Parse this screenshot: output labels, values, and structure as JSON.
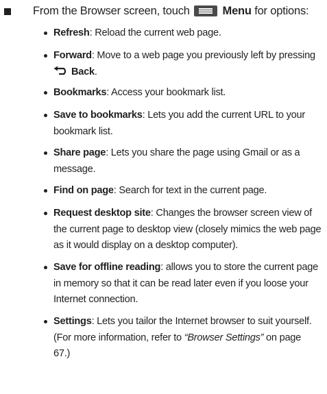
{
  "intro": {
    "before": "From the Browser screen, touch ",
    "menu_label": "Menu",
    "after": " for options:"
  },
  "items": [
    {
      "term": "Refresh",
      "line1": ": Reload the current web page."
    },
    {
      "term": "Forward",
      "line1": ": Move to a web page you previously left by pressing",
      "back_label": "Back",
      "back_after": "."
    },
    {
      "term": "Bookmarks",
      "line1": ": Access your bookmark list."
    },
    {
      "term": "Save to bookmarks",
      "line1": ": Lets you add the current URL to your",
      "line2": "bookmark list."
    },
    {
      "term": "Share page",
      "line1": ": Lets you share the page using Gmail or as a",
      "line2": "message."
    },
    {
      "term": "Find on page",
      "line1": ": Search for text in the current page."
    },
    {
      "term": "Request desktop site",
      "line1": ": Changes the browser screen view of",
      "line2": "the current page to desktop view (closely mimics the web page",
      "line3": "as it would display on a desktop computer)."
    },
    {
      "term": "Save for offline reading",
      "line1": ": allows you to store the current page",
      "line2": "in memory so that it can be read later even if you loose your",
      "line3": "Internet connection."
    },
    {
      "term": "Settings",
      "line1": ": Lets you tailor the Internet browser to suit yourself.",
      "line2_before": "(For more information, refer to ",
      "line2_ref": "“Browser Settings”",
      "line2_after": " on page",
      "line3": "67.)"
    }
  ]
}
